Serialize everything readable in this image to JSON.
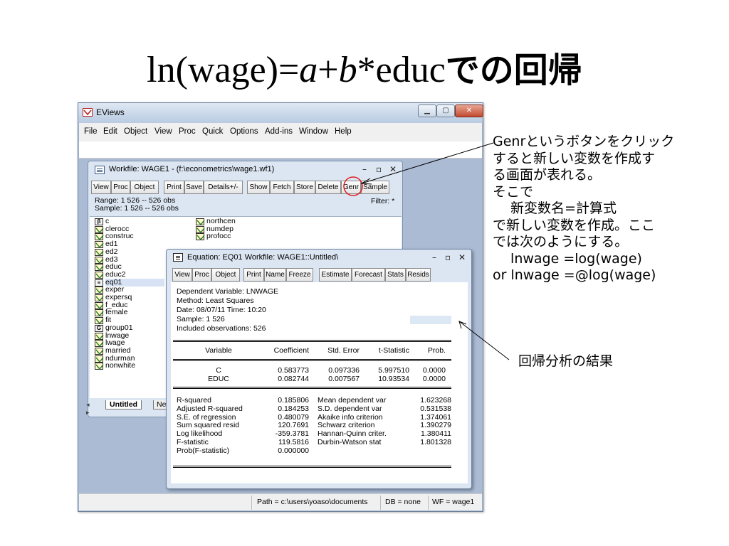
{
  "slide": {
    "title_part1": "ln(wage)=",
    "title_a": "a",
    "title_plus": "+",
    "title_b": "b",
    "title_part2": "*educ",
    "title_ja": "での回帰"
  },
  "app_window": {
    "title": "EViews",
    "menu": [
      "File",
      "Edit",
      "Object",
      "View",
      "Proc",
      "Quick",
      "Options",
      "Add-ins",
      "Window",
      "Help"
    ],
    "status": {
      "path": "Path = c:\\users\\yoaso\\documents",
      "db": "DB = none",
      "wf": "WF = wage1"
    }
  },
  "workfile": {
    "title": "Workfile: WAGE1 - (f:\\econometrics\\wage1.wf1)",
    "buttons": [
      "View",
      "Proc",
      "Object",
      "Print",
      "Save",
      "Details+/-",
      "Show",
      "Fetch",
      "Store",
      "Delete",
      "Genr",
      "Sample"
    ],
    "range": "Range:  1 526   --  526 obs",
    "sample": "Sample: 1 526   --  526 obs",
    "filter": "Filter: *",
    "objects_col1": [
      {
        "icon": "b",
        "name": "c"
      },
      {
        "icon": "s",
        "name": "clerocc"
      },
      {
        "icon": "s",
        "name": "construc"
      },
      {
        "icon": "s",
        "name": "ed1"
      },
      {
        "icon": "s",
        "name": "ed2"
      },
      {
        "icon": "s",
        "name": "ed3"
      },
      {
        "icon": "s",
        "name": "educ"
      },
      {
        "icon": "s",
        "name": "educ2"
      },
      {
        "icon": "e",
        "name": "eq01"
      },
      {
        "icon": "s",
        "name": "exper"
      },
      {
        "icon": "s",
        "name": "expersq"
      },
      {
        "icon": "s",
        "name": "f_educ"
      },
      {
        "icon": "s",
        "name": "female"
      },
      {
        "icon": "s",
        "name": "fit"
      },
      {
        "icon": "g",
        "name": "group01"
      },
      {
        "icon": "s",
        "name": "lnwage"
      },
      {
        "icon": "s",
        "name": "lwage"
      },
      {
        "icon": "s",
        "name": "married"
      },
      {
        "icon": "s",
        "name": "ndurman"
      },
      {
        "icon": "s",
        "name": "nonwhite"
      }
    ],
    "objects_col2": [
      {
        "icon": "s",
        "name": "northcen"
      },
      {
        "icon": "s",
        "name": "numdep"
      },
      {
        "icon": "s",
        "name": "profocc"
      }
    ],
    "tab_active": "Untitled",
    "tab_next": "Ne"
  },
  "equation": {
    "title": "Equation: EQ01   Workfile: WAGE1::Untitled\\",
    "buttons": [
      "View",
      "Proc",
      "Object",
      "Print",
      "Name",
      "Freeze",
      "Estimate",
      "Forecast",
      "Stats",
      "Resids"
    ],
    "header": [
      "Dependent Variable: LNWAGE",
      "Method: Least Squares",
      "Date: 08/07/11   Time: 10:20",
      "Sample: 1 526",
      "Included observations: 526"
    ],
    "columns": [
      "Variable",
      "Coefficient",
      "Std. Error",
      "t-Statistic",
      "Prob."
    ],
    "rows": [
      {
        "variable": "C",
        "coef": "0.583773",
        "se": "0.097336",
        "t": "5.997510",
        "p": "0.0000"
      },
      {
        "variable": "EDUC",
        "coef": "0.082744",
        "se": "0.007567",
        "t": "10.93534",
        "p": "0.0000"
      }
    ],
    "stats_left": [
      {
        "label": "R-squared",
        "value": "0.185806"
      },
      {
        "label": "Adjusted R-squared",
        "value": "0.184253"
      },
      {
        "label": "S.E. of regression",
        "value": "0.480079"
      },
      {
        "label": "Sum squared resid",
        "value": "120.7691"
      },
      {
        "label": "Log likelihood",
        "value": "-359.3781"
      },
      {
        "label": "F-statistic",
        "value": "119.5816"
      },
      {
        "label": "Prob(F-statistic)",
        "value": "0.000000"
      }
    ],
    "stats_right": [
      {
        "label": "Mean dependent var",
        "value": "1.623268"
      },
      {
        "label": "S.D. dependent var",
        "value": "0.531538"
      },
      {
        "label": "Akaike info criterion",
        "value": "1.374061"
      },
      {
        "label": "Schwarz criterion",
        "value": "1.390279"
      },
      {
        "label": "Hannan-Quinn criter.",
        "value": "1.380411"
      },
      {
        "label": "Durbin-Watson stat",
        "value": "1.801328"
      }
    ]
  },
  "annotations": {
    "genr_note": [
      "Genrというボタンをクリック",
      "すると新しい変数を作成す",
      "る画面が表れる。",
      "そこで",
      "　 新変数名=計算式",
      "で新しい変数を作成。ここ",
      "では次のようにする。",
      "　 lnwage =log(wage)",
      "or  lnwage =@log(wage)"
    ],
    "result_note": "回帰分析の結果",
    "highlight_color": "#e02020"
  }
}
